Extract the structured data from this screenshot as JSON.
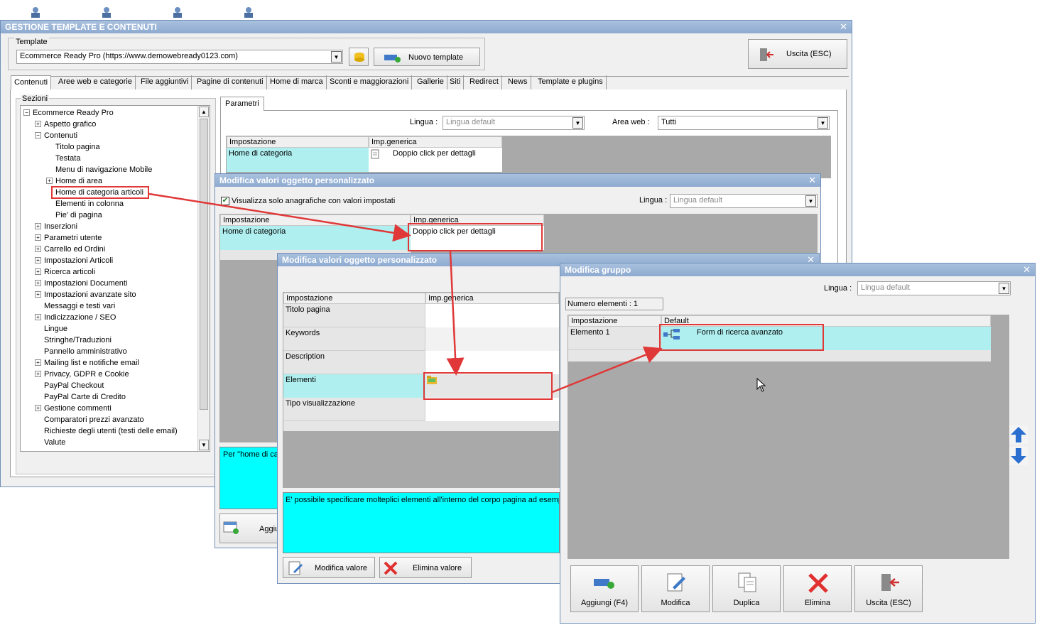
{
  "main_window": {
    "title": "GESTIONE TEMPLATE E CONTENUTI",
    "template_group_label": "Template",
    "template_value": "Ecommerce Ready Pro (https://www.demowebready0123.com)",
    "new_template_label": "Nuovo template",
    "exit_label": "Uscita (ESC)",
    "tabs": [
      "Contenuti",
      "Aree web e categorie",
      "File aggiuntivi",
      "Pagine di contenuti",
      "Home di marca",
      "Sconti e maggiorazioni",
      "Gallerie",
      "Siti",
      "Redirect",
      "News",
      "Template e plugins"
    ],
    "sections_label": "Sezioni",
    "tree": [
      {
        "label": "Ecommerce Ready Pro",
        "level": 0,
        "expander": "−"
      },
      {
        "label": "Aspetto grafico",
        "level": 1,
        "expander": "+"
      },
      {
        "label": "Contenuti",
        "level": 1,
        "expander": "−"
      },
      {
        "label": "Titolo pagina",
        "level": 2,
        "expander": ""
      },
      {
        "label": "Testata",
        "level": 2,
        "expander": ""
      },
      {
        "label": "Menu di navigazione Mobile",
        "level": 2,
        "expander": ""
      },
      {
        "label": "Home di area",
        "level": 2,
        "expander": "+"
      },
      {
        "label": "Home di categoria articoli",
        "level": 2,
        "expander": ""
      },
      {
        "label": "Elementi in colonna",
        "level": 2,
        "expander": ""
      },
      {
        "label": "Pie' di pagina",
        "level": 2,
        "expander": ""
      },
      {
        "label": "Inserzioni",
        "level": 1,
        "expander": "+"
      },
      {
        "label": "Parametri utente",
        "level": 1,
        "expander": "+"
      },
      {
        "label": "Carrello ed Ordini",
        "level": 1,
        "expander": "+"
      },
      {
        "label": "Impostazioni Articoli",
        "level": 1,
        "expander": "+"
      },
      {
        "label": "Ricerca articoli",
        "level": 1,
        "expander": "+"
      },
      {
        "label": "Impostazioni Documenti",
        "level": 1,
        "expander": "+"
      },
      {
        "label": "Impostazioni avanzate sito",
        "level": 1,
        "expander": "+"
      },
      {
        "label": "Messaggi e testi vari",
        "level": 1,
        "expander": ""
      },
      {
        "label": "Indicizzazione / SEO",
        "level": 1,
        "expander": "+"
      },
      {
        "label": "Lingue",
        "level": 1,
        "expander": ""
      },
      {
        "label": "Stringhe/Traduzioni",
        "level": 1,
        "expander": ""
      },
      {
        "label": "Pannello amministrativo",
        "level": 1,
        "expander": ""
      },
      {
        "label": "Mailing list e notifiche email",
        "level": 1,
        "expander": "+"
      },
      {
        "label": "Privacy, GDPR e Cookie",
        "level": 1,
        "expander": "+"
      },
      {
        "label": "PayPal Checkout",
        "level": 1,
        "expander": ""
      },
      {
        "label": "PayPal Carte di Credito",
        "level": 1,
        "expander": ""
      },
      {
        "label": "Gestione commenti",
        "level": 1,
        "expander": "+"
      },
      {
        "label": "Comparatori prezzi avanzato",
        "level": 1,
        "expander": ""
      },
      {
        "label": "Richieste degli utenti (testi delle email)",
        "level": 1,
        "expander": ""
      },
      {
        "label": "Valute",
        "level": 1,
        "expander": ""
      }
    ],
    "params_tab": "Parametri",
    "lingua_label": "Lingua :",
    "lingua_value": "Lingua default",
    "area_web_label": "Area web :",
    "area_web_value": "Tutti",
    "grid_headers": [
      "Impostazione",
      "Imp.generica"
    ],
    "grid_row": {
      "setting": "Home di categoria",
      "value": "Doppio click per dettagli"
    }
  },
  "dialog1": {
    "title": "Modifica valori oggetto personalizzato",
    "checkbox_label": "Visualizza solo anagrafiche con valori impostati",
    "lingua_label": "Lingua :",
    "lingua_value": "Lingua default",
    "grid_headers": [
      "Impostazione",
      "Imp.generica"
    ],
    "grid_row": {
      "setting": "Home di categoria",
      "value": "Doppio click per dettagli"
    },
    "description_text": "Per \"home di cat",
    "add_label": "Aggiu"
  },
  "dialog2": {
    "title": "Modifica valori oggetto personalizzato",
    "grid_headers": [
      "Impostazione",
      "Imp.generica"
    ],
    "rows": [
      "Titolo pagina",
      "Keywords",
      "Description",
      "Elementi",
      "Tipo visualizzazione"
    ],
    "description_text": "E' possibile specificare molteplici elementi all'interno del corpo pagina ad esempio ur",
    "edit_label": "Modifica valore",
    "delete_label": "Elimina valore"
  },
  "dialog3": {
    "title": "Modifica gruppo",
    "lingua_label": "Lingua :",
    "lingua_value": "Lingua default",
    "count_label": "Numero elementi : 1",
    "grid_headers": [
      "Impostazione",
      "Default"
    ],
    "row": {
      "setting": "Elemento 1",
      "value": "Form di ricerca avanzato"
    },
    "buttons": [
      "Aggiungi (F4)",
      "Modifica",
      "Duplica",
      "Elimina",
      "Uscita (ESC)"
    ]
  },
  "colors": {
    "cyan": "#b0eff0",
    "bright_cyan": "#00ffff",
    "title_blue": "#8eaad0",
    "annotation_red": "#e03838"
  }
}
